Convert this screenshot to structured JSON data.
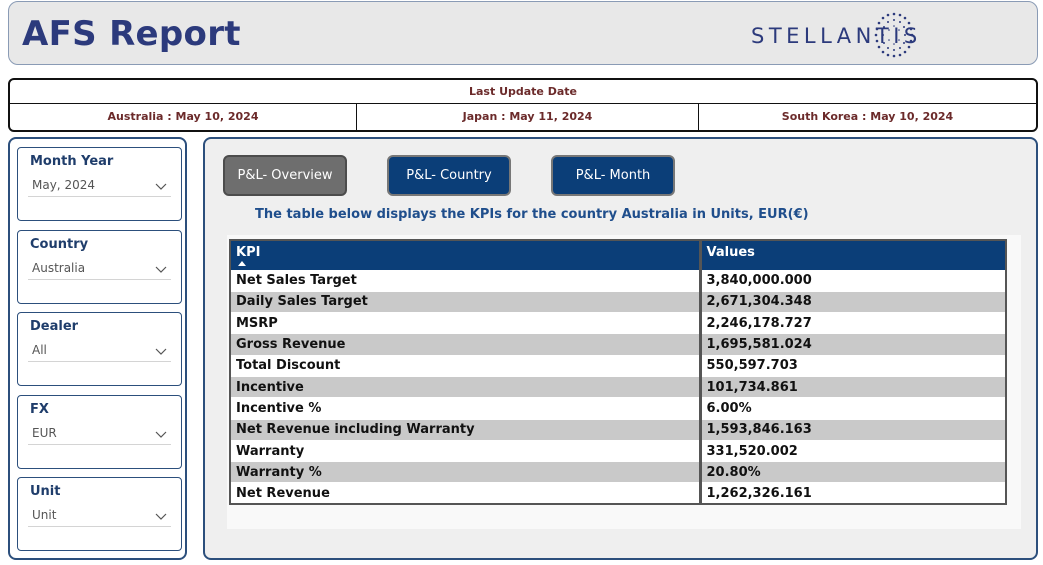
{
  "header": {
    "title": "AFS Report",
    "logo_text": "STELLANTIS"
  },
  "last_update": {
    "title": "Last Update Date",
    "australia": "Australia : May 10, 2024",
    "japan": "Japan : May 11, 2024",
    "south_korea": "South Korea : May 10, 2024"
  },
  "filters": [
    {
      "label": "Month Year",
      "value": "May, 2024"
    },
    {
      "label": "Country",
      "value": "Australia"
    },
    {
      "label": "Dealer",
      "value": "All"
    },
    {
      "label": "FX",
      "value": "EUR"
    },
    {
      "label": "Unit",
      "value": "Unit"
    }
  ],
  "tabs": [
    {
      "label": "P&L- Overview",
      "active": true
    },
    {
      "label": "P&L- Country",
      "active": false
    },
    {
      "label": "P&L- Month",
      "active": false
    }
  ],
  "caption": "The table below displays the KPIs for the country Australia in Units, EUR(€)",
  "table": {
    "columns": [
      "KPI",
      "Values"
    ],
    "rows": [
      {
        "kpi": "Net Sales Target",
        "value": "3,840,000.000"
      },
      {
        "kpi": "Daily Sales Target",
        "value": "2,671,304.348"
      },
      {
        "kpi": "MSRP",
        "value": "2,246,178.727"
      },
      {
        "kpi": "Gross Revenue",
        "value": "1,695,581.024"
      },
      {
        "kpi": "Total Discount",
        "value": "550,597.703"
      },
      {
        "kpi": "Incentive",
        "value": "101,734.861"
      },
      {
        "kpi": "Incentive %",
        "value": "6.00%"
      },
      {
        "kpi": "Net Revenue including Warranty",
        "value": "1,593,846.163"
      },
      {
        "kpi": "Warranty",
        "value": "331,520.002"
      },
      {
        "kpi": "Warranty %",
        "value": "20.80%"
      },
      {
        "kpi": "Net Revenue",
        "value": "1,262,326.161"
      }
    ]
  },
  "colors": {
    "brand_navy": "#2c3a7c",
    "tab_active": "#6e6e6e",
    "tab_inactive": "#0b3e78",
    "table_header": "#0b3e78",
    "date_text": "#6b2a2a"
  }
}
